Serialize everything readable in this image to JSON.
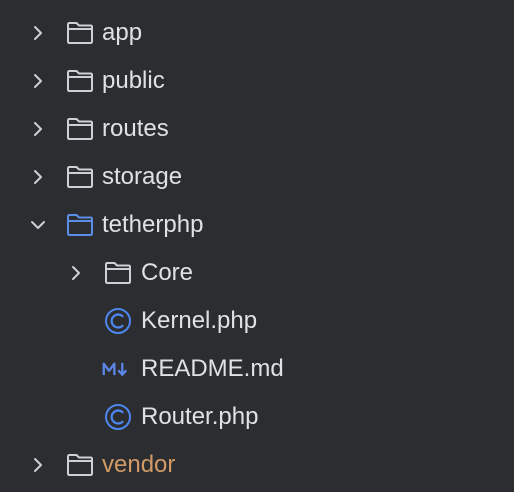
{
  "colors": {
    "background": "#2b2d30",
    "text": "#dfe1e5",
    "excluded_text": "#d19a66",
    "folder_icon": "#ced0d6",
    "expanded_folder_icon": "#5c8ee8",
    "class_icon": "#4d87ee",
    "markdown_icon": "#5b86e5"
  },
  "tree": {
    "items": [
      {
        "label": "app",
        "icon": "folder-icon",
        "state": "collapsed"
      },
      {
        "label": "public",
        "icon": "folder-icon",
        "state": "collapsed"
      },
      {
        "label": "routes",
        "icon": "folder-icon",
        "state": "collapsed"
      },
      {
        "label": "storage",
        "icon": "folder-icon",
        "state": "collapsed"
      },
      {
        "label": "tetherphp",
        "icon": "folder-open-icon",
        "state": "expanded"
      },
      {
        "label": "Core",
        "icon": "folder-icon",
        "state": "collapsed"
      },
      {
        "label": "Kernel.php",
        "icon": "php-class-icon"
      },
      {
        "label": "README.md",
        "icon": "markdown-icon"
      },
      {
        "label": "Router.php",
        "icon": "php-class-icon"
      },
      {
        "label": "vendor",
        "icon": "folder-icon",
        "state": "collapsed",
        "excluded": true
      }
    ]
  }
}
